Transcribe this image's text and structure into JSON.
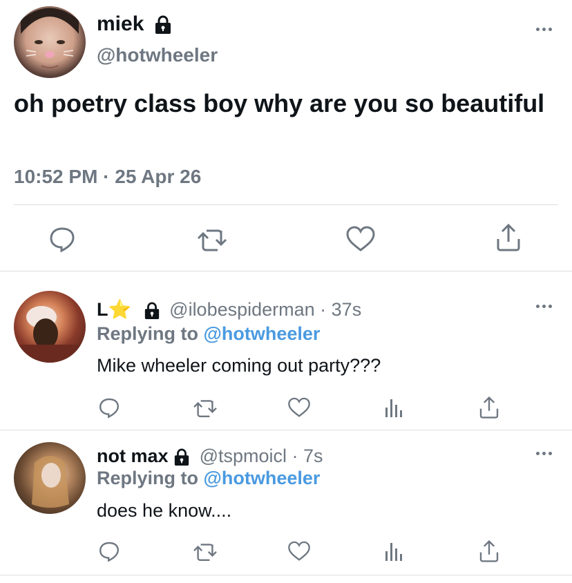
{
  "main_tweet": {
    "display_name": "miek",
    "handle": "@hotwheeler",
    "text": "oh poetry class boy why are you so beautiful",
    "timestamp": "10:52 PM · 25 Apr 26",
    "actions": [
      "reply-icon",
      "retweet-icon",
      "like-icon",
      "share-icon"
    ]
  },
  "replies": [
    {
      "display_name": "L",
      "name_emoji": "⭐",
      "handle_time": "@ilobespiderman · 37s",
      "replying_prefix": "Replying to",
      "replying_handle": "@hotwheeler",
      "text": "Mike wheeler coming out party???"
    },
    {
      "display_name": "not max",
      "handle_time": "@tspmoicl · 7s",
      "replying_prefix": "Replying to",
      "replying_handle": "@hotwheeler",
      "text": "does he know...."
    }
  ],
  "colors": {
    "text": "#0f1419",
    "muted": "#6e7781",
    "link": "#4a9ae0",
    "divider": "#dadde1"
  }
}
